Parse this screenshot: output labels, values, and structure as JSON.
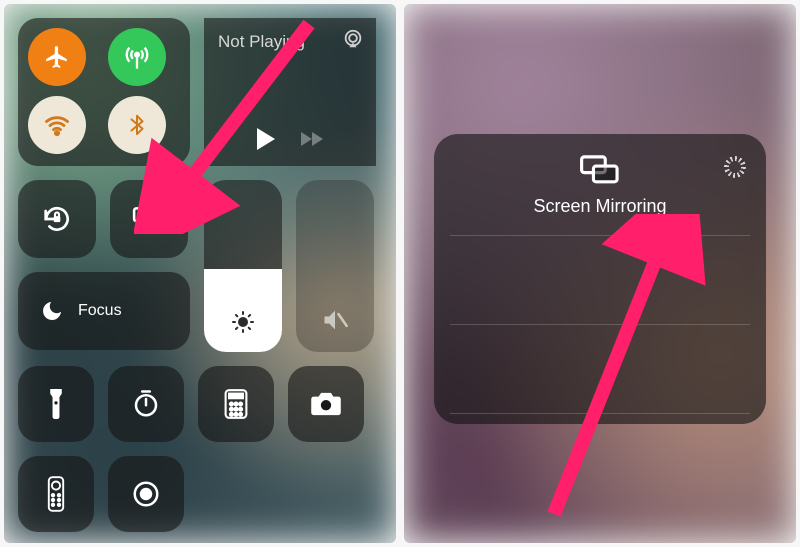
{
  "media": {
    "status": "Not Playing"
  },
  "focus": {
    "label": "Focus"
  },
  "mirror": {
    "title": "Screen Mirroring"
  },
  "icons": {
    "airplane": "airplane-icon",
    "antenna": "cellular-antenna-icon",
    "wifi": "wifi-icon",
    "bluetooth": "bluetooth-icon",
    "airplay": "airplay-icon",
    "play": "play-icon",
    "fastforward": "fast-forward-icon",
    "rotation_lock": "rotation-lock-icon",
    "screen_mirror": "screen-mirroring-icon",
    "moon": "moon-icon",
    "brightness": "brightness-icon",
    "mute": "mute-icon",
    "flashlight": "flashlight-icon",
    "timer": "timer-icon",
    "calculator": "calculator-icon",
    "camera": "camera-icon",
    "remote": "apple-tv-remote-icon",
    "record": "screen-record-icon",
    "spinner": "loading-spinner-icon"
  },
  "annotation": {
    "arrow_color": "#ff1f6b"
  }
}
